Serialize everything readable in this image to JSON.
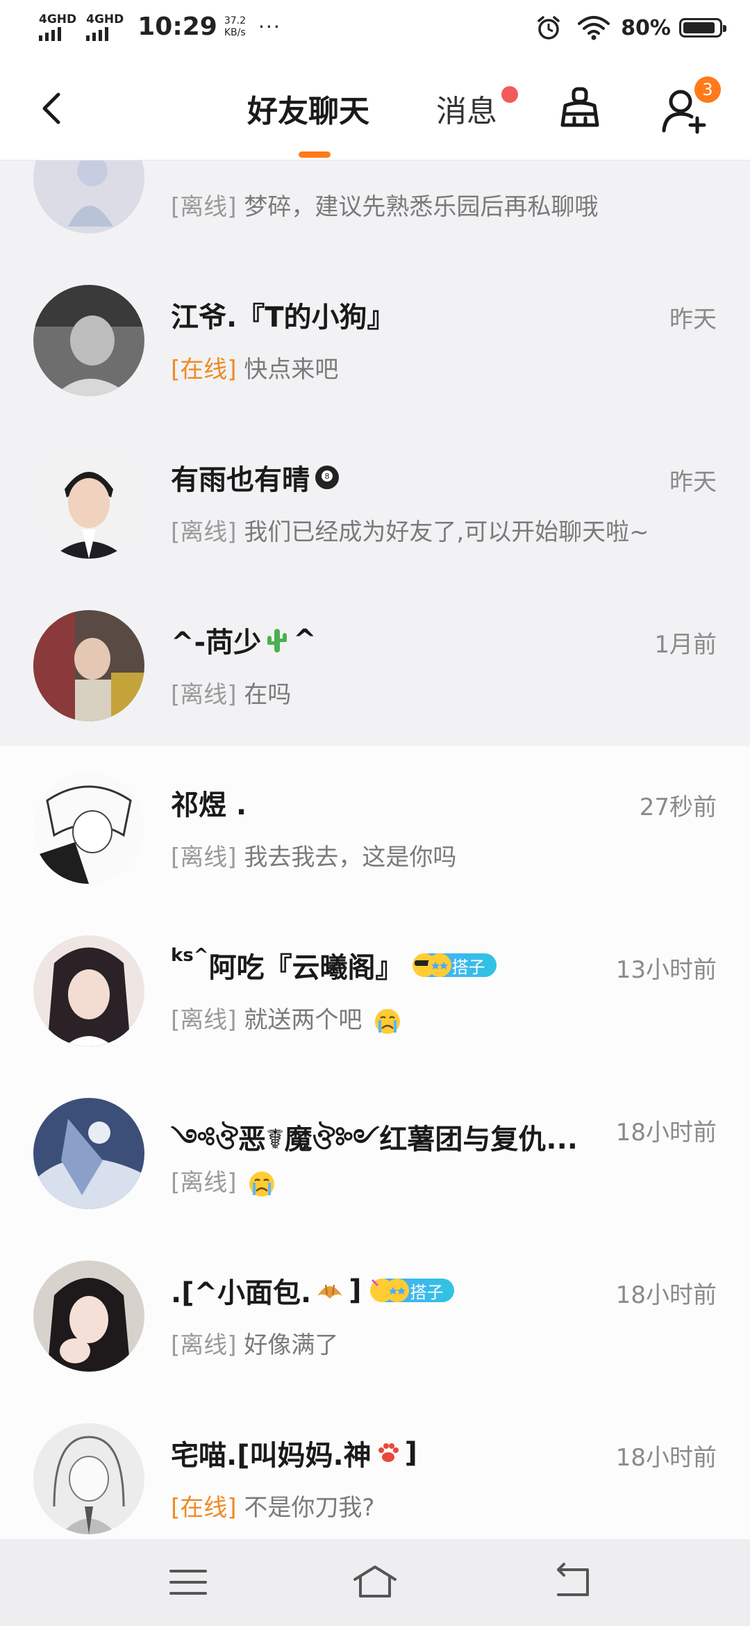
{
  "status_bar": {
    "network_1": "4GHD",
    "network_2": "4GHD",
    "time": "10:29",
    "speed_value": "37.2",
    "speed_unit": "KB/s",
    "more": "···",
    "battery": "80%"
  },
  "header": {
    "tab_friends": "好友聊天",
    "tab_messages": "消息",
    "friend_request_count": "3",
    "accent_color": "#ff7a1a"
  },
  "chats": [
    {
      "name": "",
      "time": "",
      "status": "[离线]",
      "online": false,
      "message": "梦碎，建议先熟悉乐园后再私聊哦"
    },
    {
      "name": "江爷.『T的小狗』",
      "time": "昨天",
      "status": "[在线]",
      "online": true,
      "message": "快点来吧"
    },
    {
      "name": "有雨也有晴",
      "time": "昨天",
      "status": "[离线]",
      "online": false,
      "message": "我们已经成为好友了,可以开始聊天啦~"
    },
    {
      "name": "^-苘少",
      "name_suffix": "^",
      "time": "1月前",
      "status": "[离线]",
      "online": false,
      "message": "在吗"
    },
    {
      "name": "祁煜 .",
      "time": "27秒前",
      "status": "[离线]",
      "online": false,
      "message": "我去我去，这是你吗"
    },
    {
      "name_prefix": "ks^",
      "name": "阿吃『云曦阁』",
      "tag": "搭子",
      "time": "13小时前",
      "status": "[离线]",
      "online": false,
      "message": "就送两个吧"
    },
    {
      "name": "༺ঔ恶☤魔ঔ༻红薯团与复仇...",
      "time": "18小时前",
      "status": "[离线]",
      "online": false,
      "message": ""
    },
    {
      "name": ".[^小面包.",
      "name_suffix": "]",
      "tag": "搭子",
      "time": "18小时前",
      "status": "[离线]",
      "online": false,
      "message": "好像满了"
    },
    {
      "name": "宅喵.[叫妈妈.神",
      "name_suffix": "]",
      "time": "18小时前",
      "status": "[在线]",
      "online": true,
      "message": "不是你刀我?"
    }
  ]
}
